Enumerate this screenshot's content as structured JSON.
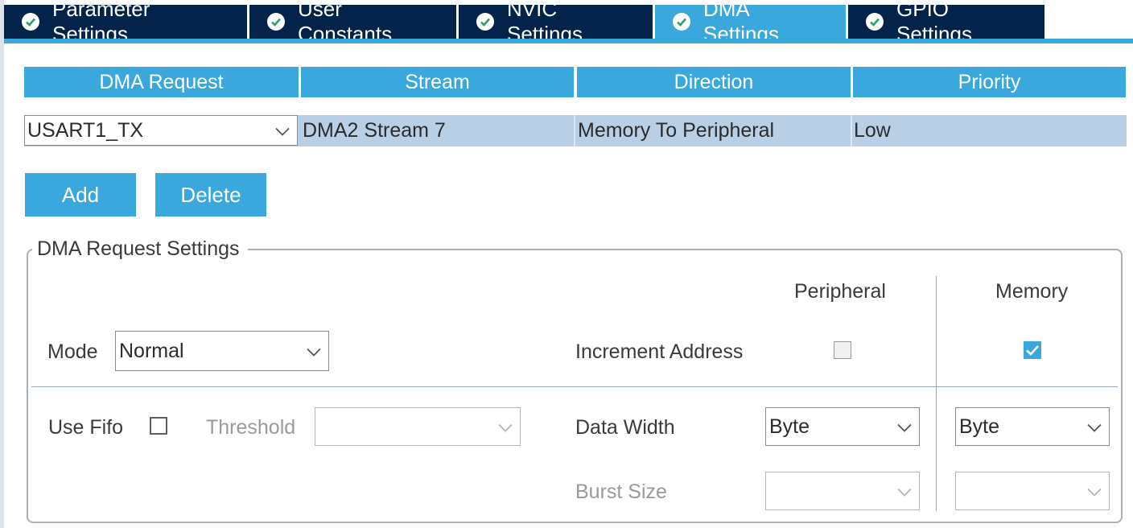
{
  "tabs": [
    {
      "label": "Parameter Settings",
      "active": false
    },
    {
      "label": "User Constants",
      "active": false
    },
    {
      "label": "NVIC Settings",
      "active": false
    },
    {
      "label": "DMA Settings",
      "active": true
    },
    {
      "label": "GPIO Settings",
      "active": false
    }
  ],
  "table": {
    "headers": [
      "DMA Request",
      "Stream",
      "Direction",
      "Priority"
    ],
    "rows": [
      {
        "request": "USART1_TX",
        "stream": "DMA2 Stream 7",
        "direction": "Memory To Peripheral",
        "priority": "Low"
      }
    ]
  },
  "buttons": {
    "add": "Add",
    "delete": "Delete"
  },
  "settings": {
    "legend": "DMA Request Settings",
    "col_peripheral": "Peripheral",
    "col_memory": "Memory",
    "mode_label": "Mode",
    "mode_value": "Normal",
    "increment_label": "Increment Address",
    "increment_peripheral": false,
    "increment_memory": true,
    "use_fifo_label": "Use Fifo",
    "use_fifo": false,
    "threshold_label": "Threshold",
    "threshold_value": "",
    "data_width_label": "Data Width",
    "data_width_peripheral": "Byte",
    "data_width_memory": "Byte",
    "burst_label": "Burst Size",
    "burst_peripheral": "",
    "burst_memory": ""
  },
  "colors": {
    "accent": "#3aa8dc",
    "tab_dark": "#03234b",
    "row_selected": "#b8cfe6"
  },
  "icons": {
    "tab_status": "check-circle-icon",
    "dropdown": "chevron-down-icon",
    "checkbox_on": "check-icon"
  }
}
